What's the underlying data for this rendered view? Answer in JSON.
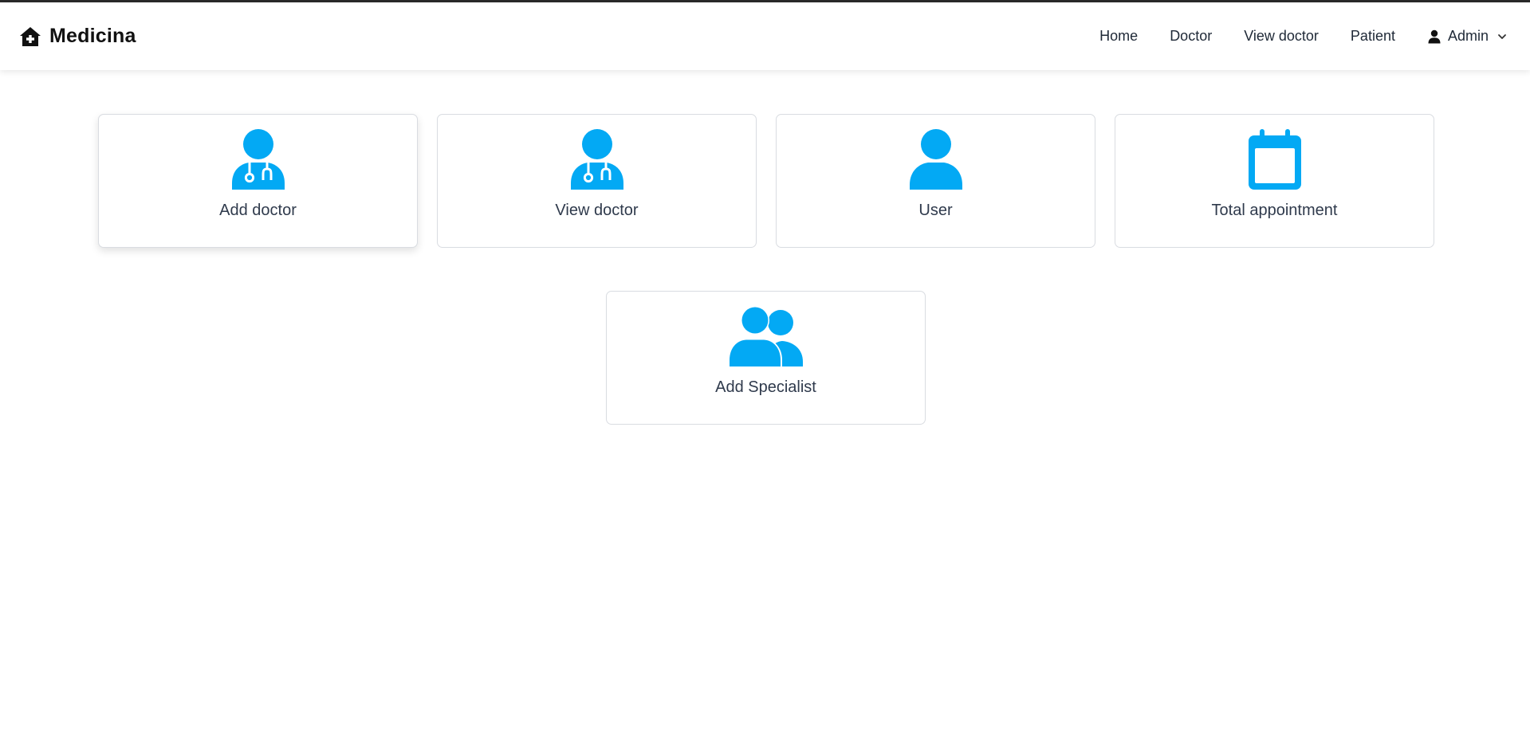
{
  "brand": {
    "name": "Medicina",
    "icon": "house-medical-icon"
  },
  "nav": {
    "items": [
      {
        "label": "Home"
      },
      {
        "label": "Doctor"
      },
      {
        "label": "View doctor"
      },
      {
        "label": "Patient"
      }
    ],
    "user": {
      "label": "Admin",
      "icon": "user-icon",
      "caret": "chevron-down-icon"
    }
  },
  "cards": [
    {
      "label": "Add doctor",
      "icon": "user-doctor-icon"
    },
    {
      "label": "View doctor",
      "icon": "user-doctor-icon"
    },
    {
      "label": "User",
      "icon": "user-icon"
    },
    {
      "label": "Total appointment",
      "icon": "calendar-icon"
    },
    {
      "label": "Add Specialist",
      "icon": "users-icon"
    }
  ],
  "colors": {
    "accent": "#03a9f4",
    "text": "#2f3a4c",
    "card_border": "#d9dce1",
    "top_line": "#2a2a2a"
  }
}
